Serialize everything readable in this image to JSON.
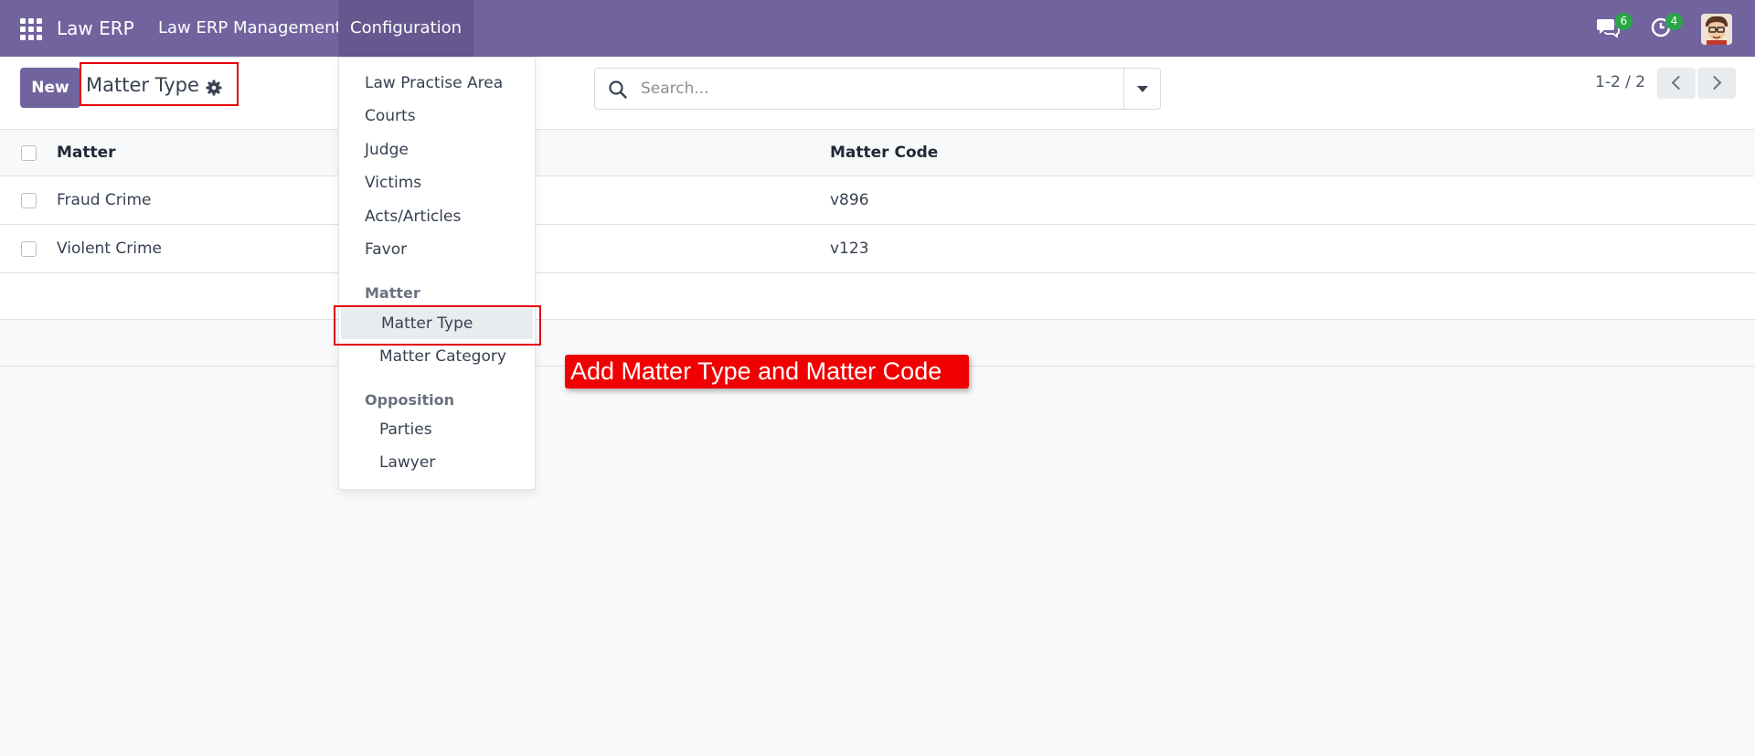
{
  "navbar": {
    "brand": "Law ERP",
    "menus": [
      "Law ERP Management",
      "Configuration"
    ],
    "messages_badge": "6",
    "activities_badge": "4",
    "color": "#71639e"
  },
  "control_panel": {
    "new_label": "New",
    "title": "Matter Type",
    "search_placeholder": "Search...",
    "pager": "1-2 / 2"
  },
  "list": {
    "columns": [
      "Matter",
      "Matter Code"
    ],
    "rows": [
      {
        "matter": "Fraud Crime",
        "code": "v896"
      },
      {
        "matter": "Violent Crime",
        "code": "v123"
      }
    ]
  },
  "dropdown": {
    "items": [
      "Law Practise Area",
      "Courts",
      "Judge",
      "Victims",
      "Acts/Articles",
      "Favor"
    ],
    "sections": [
      {
        "header": "Matter",
        "items": [
          "Matter Type",
          "Matter Category"
        ]
      },
      {
        "header": "Opposition",
        "items": [
          "Parties",
          "Lawyer"
        ]
      }
    ],
    "active_item": "Matter Type"
  },
  "annotation": {
    "text": "Add Matter Type and Matter Code",
    "highlight_color": "#e5000c"
  }
}
